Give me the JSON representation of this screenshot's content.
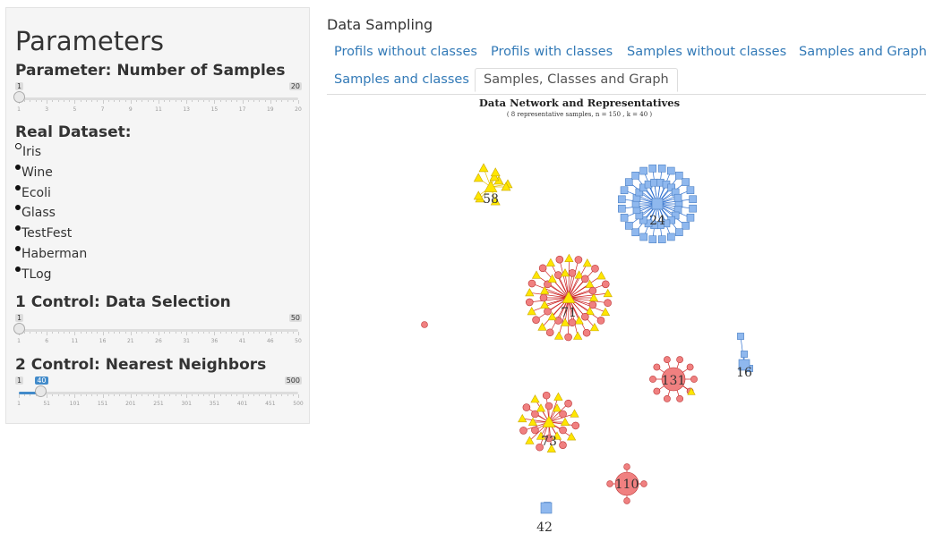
{
  "sidebar": {
    "title": "Parameters",
    "samples_heading": "Parameter: Number of Samples",
    "samples_slider": {
      "min": "1",
      "max": "20",
      "value": "1",
      "value_fraction": 0.0,
      "ticks": [
        "1",
        "3",
        "5",
        "7",
        "9",
        "11",
        "13",
        "15",
        "17",
        "19",
        "20"
      ]
    },
    "dataset_heading": "Real Dataset:",
    "datasets": [
      "Iris",
      "Wine",
      "Ecoli",
      "Glass",
      "TestFest",
      "Haberman",
      "TLog"
    ],
    "selected_dataset": "Iris",
    "control1_heading": "1 Control: Data Selection",
    "control1_slider": {
      "min": "1",
      "max": "50",
      "value": "1",
      "value_fraction": 0.0,
      "ticks": [
        "1",
        "6",
        "11",
        "16",
        "21",
        "26",
        "31",
        "36",
        "41",
        "46",
        "50"
      ]
    },
    "control2_heading": "2 Control: Nearest Neighbors",
    "control2_slider": {
      "min": "1",
      "max": "500",
      "value": "40",
      "value_fraction": 0.078,
      "ticks": [
        "1",
        "51",
        "101",
        "151",
        "201",
        "251",
        "301",
        "351",
        "401",
        "451",
        "500"
      ]
    }
  },
  "main": {
    "title": "Data Sampling",
    "tabs": [
      {
        "label": "Profils without classes",
        "active": false
      },
      {
        "label": "Profils with classes",
        "active": false
      },
      {
        "label": "Samples without classes",
        "active": false
      },
      {
        "label": "Samples and Graph",
        "active": false
      },
      {
        "label": "Samples and classes",
        "active": false
      },
      {
        "label": "Samples, Classes and Graph",
        "active": true
      }
    ]
  },
  "graph": {
    "title": "Data Network and Representatives",
    "subtitle": "( 8 representative samples, n = 150 , k = 40 )",
    "colors": {
      "red": "#f08080",
      "red_dark": "#d6233c",
      "red_edge": "#cc2222",
      "yellow": "#ffe600",
      "blue": "#8fb8ee",
      "blue_edge": "#2d6fd0"
    },
    "clusters": [
      {
        "label": "58",
        "center_shape": "triangle"
      },
      {
        "label": "24",
        "center_shape": "square"
      },
      {
        "label": "71",
        "center_shape": "triangle"
      },
      {
        "label": "131",
        "center_shape": "circle"
      },
      {
        "label": "16",
        "center_shape": "square"
      },
      {
        "label": "73",
        "center_shape": "triangle"
      },
      {
        "label": "110",
        "center_shape": "circle"
      },
      {
        "label": "42",
        "center_shape": "square"
      }
    ]
  }
}
